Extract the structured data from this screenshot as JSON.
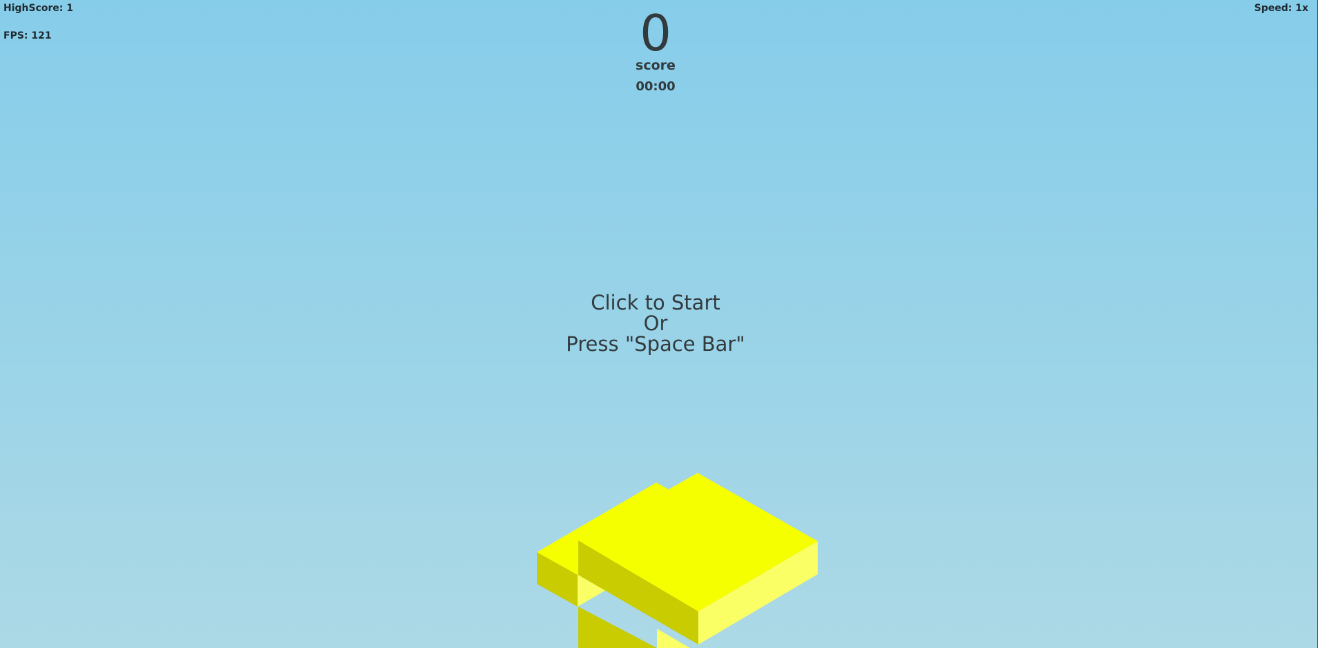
{
  "hud": {
    "highscore_label": "HighScore: 1",
    "fps_label": "FPS: 121",
    "speed_label": "Speed: 1x"
  },
  "score": {
    "value": "0",
    "label": "score",
    "timer": "00:00"
  },
  "start_message": {
    "line1": "Click to Start",
    "line2": "Or",
    "line3": "Press \"Space Bar\""
  },
  "colors": {
    "sky_top": "#86cdea",
    "sky_bottom": "#acd9e6",
    "block_top": "#f6ff00",
    "block_left": "#c8cc00",
    "block_right": "#fbff66",
    "text": "#333a3d"
  },
  "blocks": {
    "count": 2,
    "color": "yellow"
  }
}
